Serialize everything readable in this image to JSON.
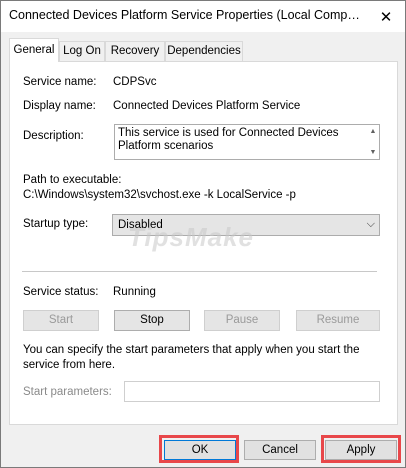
{
  "window": {
    "title": "Connected Devices Platform Service Properties (Local Comp…",
    "close_glyph": "✕"
  },
  "tabs": [
    "General",
    "Log On",
    "Recovery",
    "Dependencies"
  ],
  "general": {
    "service_name_label": "Service name:",
    "service_name": "CDPSvc",
    "display_name_label": "Display name:",
    "display_name": "Connected Devices Platform Service",
    "description_label": "Description:",
    "description": "This service is used for Connected Devices Platform scenarios",
    "path_label": "Path to executable:",
    "path": "C:\\Windows\\system32\\svchost.exe -k LocalService -p",
    "startup_type_label": "Startup type:",
    "startup_type": "Disabled",
    "service_status_label": "Service status:",
    "service_status": "Running",
    "buttons": {
      "start": "Start",
      "stop": "Stop",
      "pause": "Pause",
      "resume": "Resume"
    },
    "note": "You can specify the start parameters that apply when you start the service from here.",
    "start_params_label": "Start parameters:",
    "start_params_value": ""
  },
  "footer": {
    "ok": "OK",
    "cancel": "Cancel",
    "apply": "Apply"
  },
  "watermark": "TipsMake",
  "colors": {
    "highlight": "#e8474a",
    "default_button_border": "#0078d7"
  }
}
